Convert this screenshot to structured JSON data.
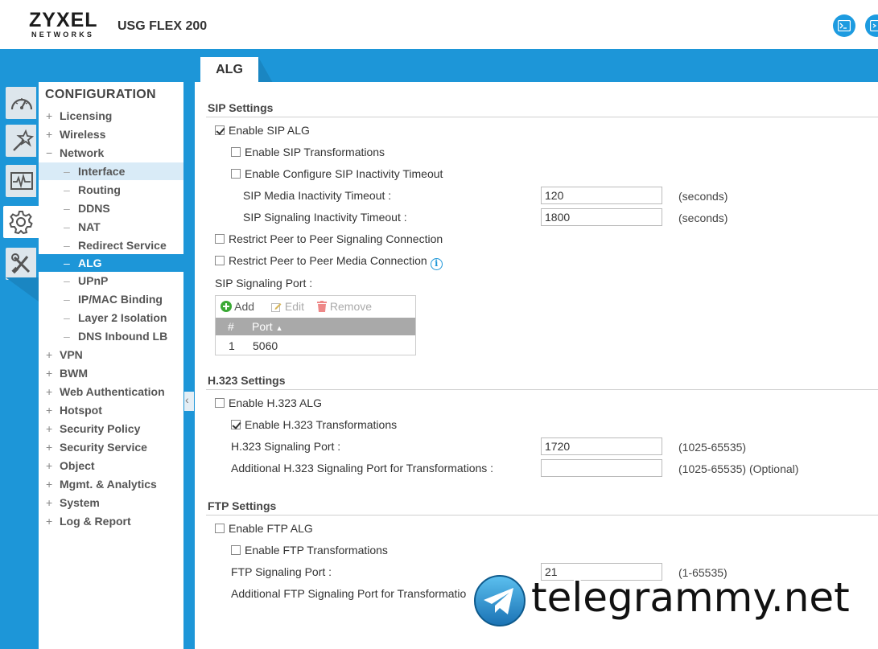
{
  "header": {
    "logo_main": "ZYXEL",
    "logo_sub": "NETWORKS",
    "model": "USG FLEX 200",
    "console_icon": "terminal-icon",
    "cli_icon": "cli-icon"
  },
  "tab": {
    "label": "ALG"
  },
  "rail": [
    "dashboard-icon",
    "wizard-icon",
    "monitor-icon",
    "configuration-gear-icon",
    "maintenance-tools-icon"
  ],
  "nav": {
    "title": "CONFIGURATION",
    "items": [
      {
        "exp": "+",
        "label": "Licensing"
      },
      {
        "exp": "+",
        "label": "Wireless"
      },
      {
        "exp": "−",
        "label": "Network"
      },
      {
        "exp": "–",
        "label": "Interface"
      },
      {
        "exp": "–",
        "label": "Routing"
      },
      {
        "exp": "–",
        "label": "DDNS"
      },
      {
        "exp": "–",
        "label": "NAT"
      },
      {
        "exp": "–",
        "label": "Redirect Service"
      },
      {
        "exp": "–",
        "label": "ALG"
      },
      {
        "exp": "–",
        "label": "UPnP"
      },
      {
        "exp": "–",
        "label": "IP/MAC Binding"
      },
      {
        "exp": "–",
        "label": "Layer 2 Isolation"
      },
      {
        "exp": "–",
        "label": "DNS Inbound LB"
      },
      {
        "exp": "+",
        "label": "VPN"
      },
      {
        "exp": "+",
        "label": "BWM"
      },
      {
        "exp": "+",
        "label": "Web Authentication"
      },
      {
        "exp": "+",
        "label": "Hotspot"
      },
      {
        "exp": "+",
        "label": "Security Policy"
      },
      {
        "exp": "+",
        "label": "Security Service"
      },
      {
        "exp": "+",
        "label": "Object"
      },
      {
        "exp": "+",
        "label": "Mgmt. & Analytics"
      },
      {
        "exp": "+",
        "label": "System"
      },
      {
        "exp": "+",
        "label": "Log & Report"
      }
    ]
  },
  "sip": {
    "title": "SIP Settings",
    "enable_alg": "Enable SIP ALG",
    "enable_alg_checked": true,
    "enable_transformations": "Enable SIP Transformations",
    "enable_timeout": "Enable Configure SIP Inactivity Timeout",
    "media_timeout_label": "SIP Media Inactivity Timeout :",
    "media_timeout_value": "120",
    "signaling_timeout_label": "SIP Signaling Inactivity Timeout :",
    "signaling_timeout_value": "1800",
    "seconds": "(seconds)",
    "restrict_signaling": "Restrict Peer to Peer Signaling Connection",
    "restrict_media": "Restrict Peer to Peer Media Connection",
    "info_glyph": "i",
    "port_label": "SIP Signaling Port :",
    "table": {
      "add": "Add",
      "edit": "Edit",
      "remove": "Remove",
      "col_index": "#",
      "col_port": "Port",
      "rows": [
        {
          "index": "1",
          "port": "5060"
        }
      ]
    }
  },
  "h323": {
    "title": "H.323 Settings",
    "enable_alg": "Enable H.323 ALG",
    "enable_transformations": "Enable H.323 Transformations",
    "signaling_port_label": "H.323 Signaling Port :",
    "signaling_port_value": "1720",
    "signaling_port_range": "(1025-65535)",
    "additional_label": "Additional H.323 Signaling Port for Transformations :",
    "additional_value": "",
    "additional_range": "(1025-65535) (Optional)"
  },
  "ftp": {
    "title": "FTP Settings",
    "enable_alg": "Enable FTP ALG",
    "enable_transformations": "Enable FTP Transformations",
    "signaling_port_label": "FTP Signaling Port :",
    "signaling_port_value": "21",
    "signaling_port_range": "(1-65535)",
    "additional_label": "Additional FTP Signaling Port for Transformatio"
  },
  "watermark": {
    "text": "telegrammy.net",
    "icon": "telegram-paper-plane-icon"
  },
  "colors": {
    "accent": "#1d96d8",
    "nav_hover": "#d9ebf7",
    "table_header": "#a9a9a9"
  }
}
